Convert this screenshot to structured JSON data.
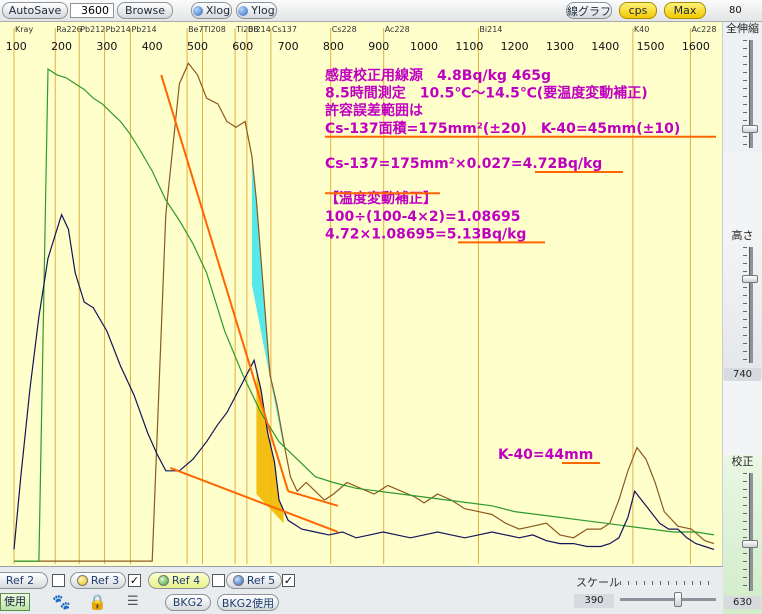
{
  "toolbar": {
    "autosave_label": "AutoSave",
    "interval_value": "3600",
    "browse_label": "Browse",
    "xlog_label": "Xlog",
    "ylog_label": "Ylog",
    "line_graph_label": "線グラフ",
    "cps_label": "cps",
    "max_label": "Max",
    "top_value": "80"
  },
  "chart_data": {
    "type": "line",
    "x_ticks": [
      100,
      200,
      300,
      400,
      500,
      600,
      700,
      800,
      900,
      1000,
      1100,
      1200,
      1300,
      1400,
      1500,
      1600
    ],
    "xlim": [
      95,
      1640
    ],
    "nuclide_markers": [
      {
        "label": "Kray",
        "x": 95
      },
      {
        "label": "Ra226",
        "x": 186
      },
      {
        "label": "Pb212",
        "x": 239
      },
      {
        "label": "Pb214",
        "x": 295
      },
      {
        "label": "Pb214",
        "x": 352
      },
      {
        "label": "Be7",
        "x": 477
      },
      {
        "label": "Tl208",
        "x": 511
      },
      {
        "label": "Tl208",
        "x": 583
      },
      {
        "label": "Bi214",
        "x": 609
      },
      {
        "label": "Cs137",
        "x": 662
      },
      {
        "label": "Cs228",
        "x": 794
      },
      {
        "label": "Ac228",
        "x": 911
      },
      {
        "label": "Bi214",
        "x": 1120
      },
      {
        "label": "K40",
        "x": 1461
      },
      {
        "label": "Ac228",
        "x": 1588
      }
    ],
    "series": [
      {
        "color": "#8b5a1e",
        "x": [
          95,
          130,
          170,
          210,
          250,
          290,
          330,
          370,
          400,
          430,
          460,
          480,
          500,
          520,
          545,
          565,
          585,
          605,
          620,
          630,
          645,
          660,
          675,
          690,
          705,
          720,
          740,
          760,
          780,
          800,
          830,
          860,
          890,
          920,
          950,
          980,
          1000,
          1030,
          1060,
          1090,
          1120,
          1150,
          1180,
          1210,
          1240,
          1270,
          1300,
          1330,
          1360,
          1390,
          1410,
          1430,
          1450,
          1470,
          1490,
          1510,
          1530,
          1560,
          1590,
          1620,
          1640
        ],
        "y": [
          1,
          1,
          1,
          1,
          1,
          1,
          1,
          1,
          1,
          120,
          165,
          172,
          168,
          160,
          158,
          152,
          150,
          152,
          140,
          125,
          95,
          65,
          55,
          42,
          30,
          25,
          28,
          25,
          22,
          24,
          28,
          26,
          24,
          27,
          25,
          23,
          21,
          24,
          22,
          19,
          18,
          17,
          14,
          12,
          13,
          14,
          10,
          9,
          12,
          12,
          14,
          22,
          32,
          40,
          36,
          28,
          18,
          13,
          12,
          8,
          7
        ]
      },
      {
        "color": "#2d9a2d",
        "x": [
          95,
          110,
          130,
          150,
          170,
          190,
          210,
          230,
          250,
          270,
          290,
          310,
          330,
          350,
          370,
          400,
          430,
          460,
          490,
          520,
          560,
          600,
          640,
          680,
          720,
          760,
          800,
          850,
          900,
          950,
          1000,
          1050,
          1100,
          1150,
          1200,
          1250,
          1300,
          1350,
          1400,
          1450,
          1500,
          1550,
          1600,
          1640
        ],
        "y": [
          1,
          1,
          1,
          1,
          170,
          168,
          167,
          165,
          163,
          160,
          158,
          155,
          152,
          148,
          143,
          135,
          125,
          118,
          110,
          100,
          80,
          65,
          52,
          42,
          36,
          30,
          28,
          26,
          25,
          24,
          23,
          22,
          21,
          20,
          18,
          17,
          16,
          15,
          14,
          13,
          12,
          11,
          11,
          10
        ]
      },
      {
        "color": "#14145a",
        "x": [
          95,
          110,
          130,
          150,
          170,
          190,
          200,
          215,
          230,
          250,
          270,
          300,
          330,
          360,
          390,
          410,
          430,
          460,
          490,
          520,
          545,
          565,
          585,
          605,
          625,
          640,
          655,
          670,
          680,
          700,
          730,
          760,
          790,
          820,
          850,
          880,
          910,
          940,
          970,
          1000,
          1030,
          1060,
          1090,
          1120,
          1150,
          1180,
          1210,
          1240,
          1270,
          1300,
          1330,
          1360,
          1390,
          1410,
          1430,
          1450,
          1465,
          1480,
          1500,
          1520,
          1540,
          1560,
          1580,
          1600,
          1620,
          1640
        ],
        "y": [
          5,
          30,
          60,
          85,
          105,
          115,
          120,
          115,
          100,
          90,
          88,
          80,
          68,
          58,
          45,
          38,
          32,
          32,
          36,
          42,
          48,
          52,
          58,
          64,
          70,
          60,
          45,
          35,
          22,
          15,
          12,
          11,
          10,
          11,
          9,
          10,
          11,
          10,
          9,
          10,
          11,
          10,
          9,
          10,
          11,
          10,
          9,
          10,
          8,
          7,
          7,
          6,
          6,
          7,
          9,
          16,
          25,
          22,
          18,
          14,
          12,
          12,
          9,
          7,
          6,
          5
        ]
      }
    ],
    "annotations": {
      "lines": [
        "感度校正用線源　4.8Bq/kg 465g",
        "8.5時間測定　10.5℃～14.5℃(要温度変動補正)",
        "許容誤差範囲は",
        "Cs-137面積=175mm²(±20)　K-40=45mm(±10)",
        "",
        "Cs-137=175mm²×0.027=4.72Bq/kg",
        "",
        "【温度変動補正】",
        "100÷(100-4×2)=1.08695",
        "4.72×1.08695=5.13Bq/kg"
      ],
      "k40_label": "K-40=44mm"
    },
    "colors": {
      "background": "#ffffcc",
      "marker_line": "#e0b040",
      "annotation_text": "#c000c0",
      "underline": "#ff6600",
      "fill_cs_upper": "#44e6ee",
      "fill_cs_lower": "#f2b800"
    }
  },
  "right_panel": {
    "fullwidth_label": "全伸縮",
    "height_label": "高さ",
    "height_value": "740",
    "calib_label": "校正",
    "calib_value": "630"
  },
  "bottom_panel": {
    "ref2_label": "Ref 2",
    "ref3_label": "Ref 3",
    "ref4_label": "Ref 4",
    "ref5_label": "Ref 5",
    "ref3_checked": "✓",
    "ref5_checked": "✓",
    "use_label": "使用",
    "bkg2_label": "BKG2",
    "bkg2_use_label": "BKG2使用",
    "scale_label": "スケール",
    "scale_value": "390"
  }
}
